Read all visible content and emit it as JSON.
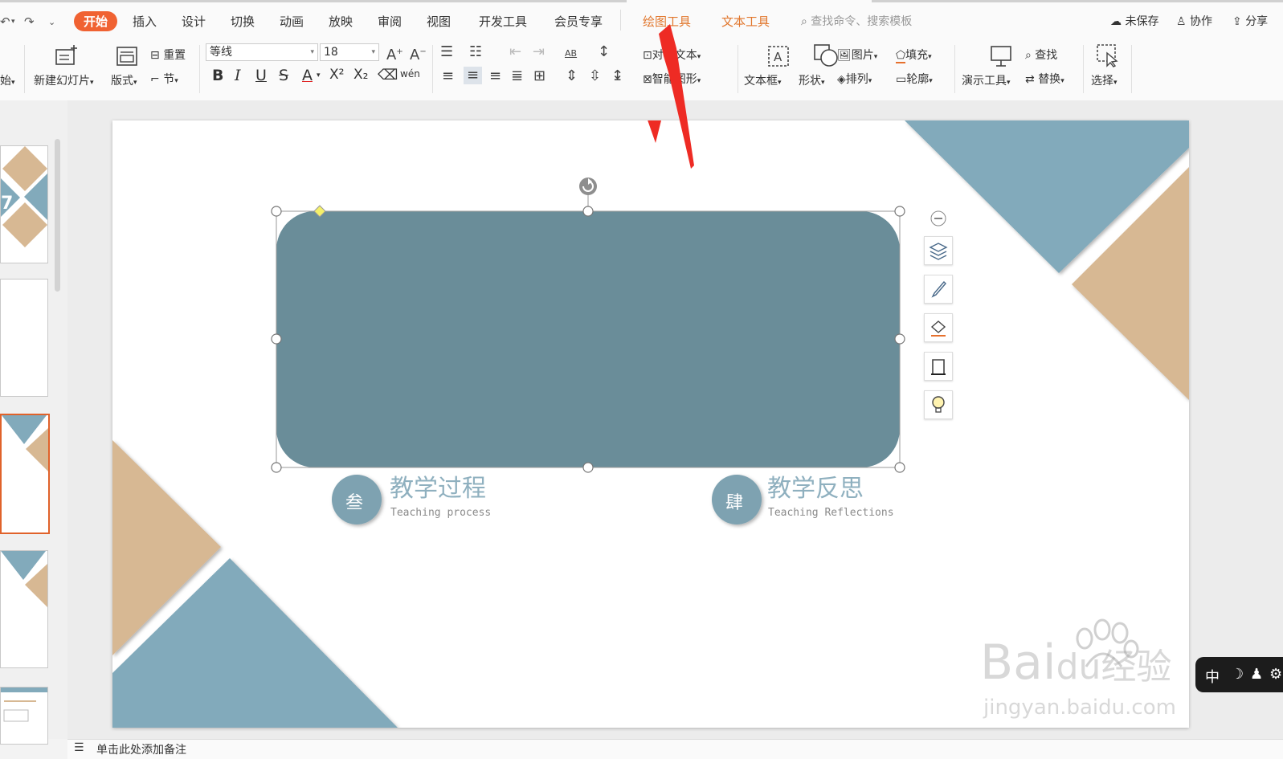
{
  "menu": {
    "tabs": [
      "开始",
      "插入",
      "设计",
      "切换",
      "动画",
      "放映",
      "审阅",
      "视图",
      "开发工具",
      "会员专享"
    ],
    "tool_tabs": [
      "绘图工具",
      "文本工具"
    ],
    "search_placeholder": "查找命令、搜索模板",
    "right": {
      "unsaved": "未保存",
      "collab": "协作",
      "share": "分享"
    }
  },
  "ribbon": {
    "start_partial": "始",
    "new_slide": "新建幻灯片",
    "layout": "版式",
    "reset": "重置",
    "section": "节",
    "font_name": "等线",
    "font_size": "18",
    "align_text": "对齐文本",
    "smart_shape": "智能图形",
    "textbox": "文本框",
    "shape": "形状",
    "picture": "图片",
    "arrange": "排列",
    "fill": "填充",
    "outline": "轮廓",
    "present_tools": "演示工具",
    "find": "查找",
    "replace": "替换",
    "select": "选择",
    "fmt_bold": "B",
    "fmt_italic": "I",
    "fmt_underline": "U",
    "fmt_strike": "S",
    "fmt_color": "A",
    "fmt_sup": "X²",
    "fmt_sub": "X₂",
    "phonetic": "wén",
    "ab_label": "AB"
  },
  "slide": {
    "items": [
      {
        "num": "叁",
        "title": "教学过程",
        "subtitle": "Teaching process"
      },
      {
        "num": "肆",
        "title": "教学反思",
        "subtitle": "Teaching Reflections"
      }
    ]
  },
  "notes_placeholder": "单击此处添加备注",
  "ime": {
    "lang": "中"
  },
  "watermark": {
    "brand": "Bai",
    "du": "du",
    "jingyan": "经验",
    "url": "jingyan.baidu.com"
  },
  "colors": {
    "accent": "#f06232",
    "tool_tab": "#e1772d",
    "shape_fill": "#6a8d99",
    "blue": "#82aabb",
    "tan": "#d7b893",
    "circle": "#7ea2b1",
    "title_text": "#8fb0bf"
  }
}
